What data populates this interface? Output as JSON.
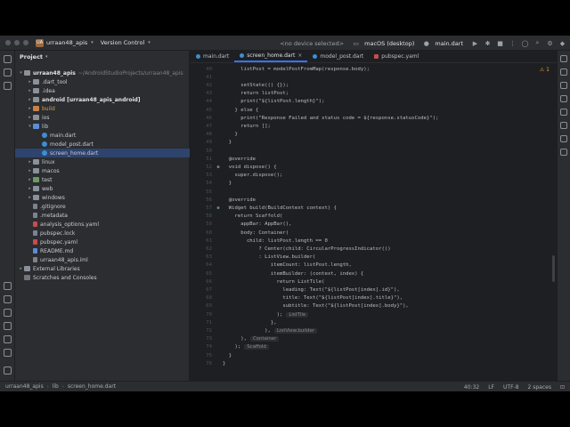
{
  "titlebar": {
    "project_badge": "UA",
    "project_name": "urraan48_apis",
    "vcs": "Version Control",
    "device": "<no device selected>",
    "run_target": "macOS (desktop)",
    "run_config": "main.dart"
  },
  "project_panel": {
    "title": "Project",
    "items": [
      {
        "label": "urraan48_apis",
        "hint": "~/AndroidStudioProjects/urraan48_apis"
      },
      {
        "label": ".dart_tool"
      },
      {
        "label": ".idea"
      },
      {
        "label": "android [urraan48_apis_android]"
      },
      {
        "label": "build"
      },
      {
        "label": "ios"
      },
      {
        "label": "lib"
      },
      {
        "label": "main.dart"
      },
      {
        "label": "model_post.dart"
      },
      {
        "label": "screen_home.dart"
      },
      {
        "label": "linux"
      },
      {
        "label": "macos"
      },
      {
        "label": "test"
      },
      {
        "label": "web"
      },
      {
        "label": "windows"
      },
      {
        "label": ".gitignore"
      },
      {
        "label": ".metadata"
      },
      {
        "label": "analysis_options.yaml"
      },
      {
        "label": "pubspec.lock"
      },
      {
        "label": "pubspec.yaml"
      },
      {
        "label": "README.md"
      },
      {
        "label": "urraan48_apis.iml"
      },
      {
        "label": "External Libraries"
      },
      {
        "label": "Scratches and Consoles"
      }
    ]
  },
  "tabs": [
    "main.dart",
    "screen_home.dart",
    "model_post.dart",
    "pubspec.yaml"
  ],
  "editor": {
    "warning": "⚠ 1",
    "lines": [
      {
        "n": "40",
        "text": "      listPost = modelPostFromMap(response.body);"
      },
      {
        "n": "41",
        "text": ""
      },
      {
        "n": "42",
        "text": "      setState(() {});"
      },
      {
        "n": "43",
        "text": "      return listPost;"
      },
      {
        "n": "44",
        "text": "      print(\"${listPost.length}\");"
      },
      {
        "n": "45",
        "text": "    } else {"
      },
      {
        "n": "46",
        "text": "      print(\"Response Failed and status code = ${response.statusCode}\");"
      },
      {
        "n": "47",
        "text": "      return [];"
      },
      {
        "n": "48",
        "text": "    }"
      },
      {
        "n": "49",
        "text": "  }"
      },
      {
        "n": "50",
        "text": ""
      },
      {
        "n": "51",
        "text": "  @override"
      },
      {
        "n": "52",
        "text": "  void dispose() {"
      },
      {
        "n": "53",
        "text": "    super.dispose();"
      },
      {
        "n": "54",
        "text": "  }"
      },
      {
        "n": "55",
        "text": ""
      },
      {
        "n": "56",
        "text": "  @override"
      },
      {
        "n": "57",
        "text": "  Widget build(BuildContext context) {"
      },
      {
        "n": "58",
        "text": "    return Scaffold("
      },
      {
        "n": "59",
        "text": "      appBar: AppBar(),"
      },
      {
        "n": "60",
        "text": "      body: Container("
      },
      {
        "n": "61",
        "text": "        child: listPost.length == 0"
      },
      {
        "n": "62",
        "text": "            ? Center(child: CircularProgressIndicator())"
      },
      {
        "n": "63",
        "text": "            : ListView.builder("
      },
      {
        "n": "64",
        "text": "                itemCount: listPost.length,"
      },
      {
        "n": "65",
        "text": "                itemBuilder: (context, index) {"
      },
      {
        "n": "66",
        "text": "                  return ListTile("
      },
      {
        "n": "67",
        "text": "                    leading: Text(\"${listPost[index].id}\"),"
      },
      {
        "n": "68",
        "text": "                    title: Text(\"${listPost[index].title}\"),"
      },
      {
        "n": "69",
        "text": "                    subtitle: Text(\"${listPost[index].body}\"),"
      },
      {
        "n": "70",
        "text": "                  );",
        "hint": "ListTile"
      },
      {
        "n": "71",
        "text": "                },"
      },
      {
        "n": "72",
        "text": "              ),",
        "hint": "ListView.builder"
      },
      {
        "n": "73",
        "text": "      ),",
        "hint": "Container"
      },
      {
        "n": "74",
        "text": "    );",
        "hint": "Scaffold"
      },
      {
        "n": "75",
        "text": "  }"
      },
      {
        "n": "76",
        "text": "}"
      }
    ]
  },
  "statusbar": {
    "crumbs": [
      "urraan48_apis",
      "lib",
      "screen_home.dart"
    ],
    "position": "40:32",
    "line_sep": "LF",
    "encoding": "UTF-8",
    "indent": "2 spaces"
  }
}
